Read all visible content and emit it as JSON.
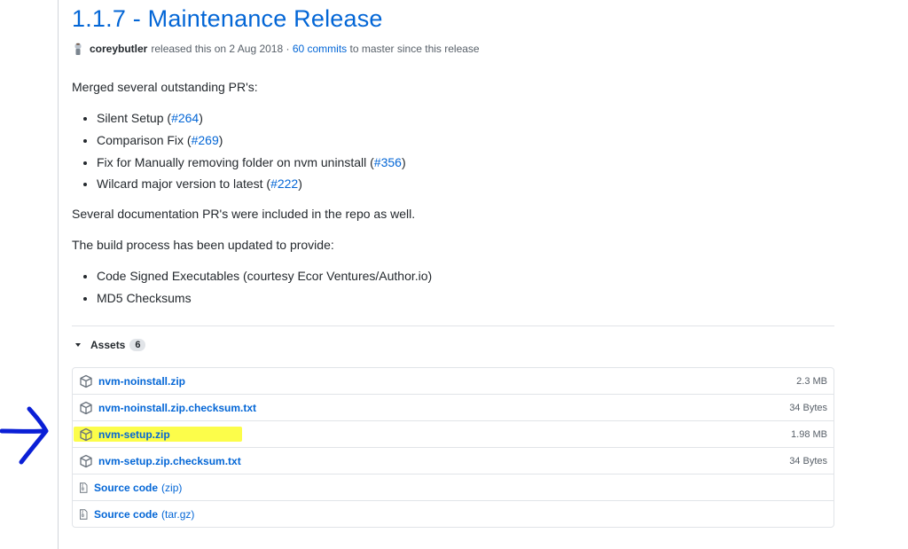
{
  "release": {
    "title": "1.1.7 - Maintenance Release",
    "author": "coreybutler",
    "released_text": "released this on 2 Aug 2018 ·",
    "commits_link": "60 commits",
    "since_text": "to master since this release"
  },
  "notes": {
    "intro": "Merged several outstanding PR's:",
    "prs": [
      {
        "text": "Silent Setup (",
        "link": "#264",
        "tail": ")"
      },
      {
        "text": "Comparison Fix (",
        "link": "#269",
        "tail": ")"
      },
      {
        "text": "Fix for Manually removing folder on nvm uninstall (",
        "link": "#356",
        "tail": ")"
      },
      {
        "text": "Wilcard major version to latest (",
        "link": "#222",
        "tail": ")"
      }
    ],
    "docs": "Several documentation PR's were included in the repo as well.",
    "build_intro": "The build process has been updated to provide:",
    "build_items": [
      "Code Signed Executables (courtesy Ecor Ventures/Author.io)",
      "MD5 Checksums"
    ]
  },
  "assets": {
    "label": "Assets",
    "count": "6",
    "files": [
      {
        "name": "nvm-noinstall.zip",
        "size": "2.3 MB"
      },
      {
        "name": "nvm-noinstall.zip.checksum.txt",
        "size": "34 Bytes"
      },
      {
        "name": "nvm-setup.zip",
        "size": "1.98 MB"
      },
      {
        "name": "nvm-setup.zip.checksum.txt",
        "size": "34 Bytes"
      }
    ],
    "sources": [
      {
        "name": "Source code",
        "format": "(zip)"
      },
      {
        "name": "Source code",
        "format": "(tar.gz)"
      }
    ]
  },
  "annotation": {
    "highlight_color": "#fbfd2a",
    "arrow_color": "#0a1fd6"
  },
  "colors": {
    "link": "#0366d6",
    "text": "#24292e",
    "muted": "#586069",
    "border": "#e1e4e8"
  }
}
